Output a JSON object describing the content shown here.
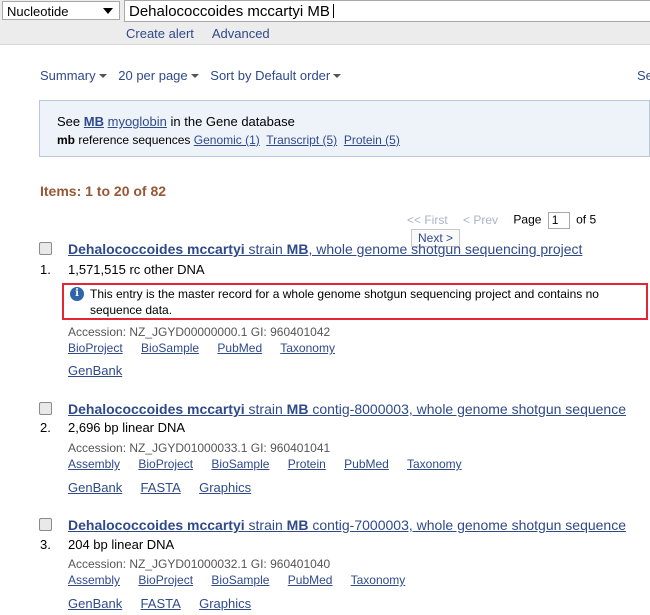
{
  "search": {
    "database": "Nucleotide",
    "query": "Dehalococcoides mccartyi MB",
    "links": [
      "Create alert",
      "Advanced"
    ]
  },
  "toolbar": {
    "summary": "Summary",
    "per_page": "20 per page",
    "sort": "Sort by Default order",
    "send": "Se"
  },
  "gene_box": {
    "see": "See",
    "gene_symbol": "MB",
    "gene_name": "myoglobin",
    "suffix": "in the Gene database",
    "ref_symbol": "mb",
    "ref_text": "reference sequences",
    "genomic": "Genomic (1)",
    "transcript": "Transcript (5)",
    "protein": "Protein (5)"
  },
  "results": {
    "items_label": "Items: 1 to 20 of 82",
    "pager": {
      "first": "<< First",
      "prev": "< Prev",
      "page_label": "Page",
      "page_value": "1",
      "of": "of 5",
      "next": "Next >"
    }
  },
  "records": [
    {
      "num": "1.",
      "title_bold1": "Dehalococcoides mccartyi",
      "title_mid": " strain ",
      "title_bold2": "MB",
      "title_rest": ", whole genome shotgun sequencing project",
      "desc": "1,571,515 rc other DNA",
      "notice": "This entry is the master record for a whole genome shotgun sequencing project and contains no sequence data.",
      "accession": "Accession: NZ_JGYD00000000.1   GI: 960401042",
      "links": [
        "BioProject",
        "BioSample",
        "PubMed",
        "Taxonomy"
      ],
      "links2": [
        "GenBank"
      ]
    },
    {
      "num": "2.",
      "title_bold1": "Dehalococcoides mccartyi",
      "title_mid": " strain ",
      "title_bold2": "MB",
      "title_rest": " contig-8000003, whole genome shotgun sequence",
      "desc": "2,696 bp linear DNA",
      "accession": "Accession: NZ_JGYD01000033.1   GI: 960401041",
      "links": [
        "Assembly",
        "BioProject",
        "BioSample",
        "Protein",
        "PubMed",
        "Taxonomy"
      ],
      "links2": [
        "GenBank",
        "FASTA",
        "Graphics"
      ]
    },
    {
      "num": "3.",
      "title_bold1": "Dehalococcoides mccartyi",
      "title_mid": " strain ",
      "title_bold2": "MB",
      "title_rest": " contig-7000003, whole genome shotgun sequence",
      "desc": "204 bp linear DNA",
      "accession": "Accession: NZ_JGYD01000032.1   GI: 960401040",
      "links": [
        "Assembly",
        "BioProject",
        "BioSample",
        "PubMed",
        "Taxonomy"
      ],
      "links2": [
        "GenBank",
        "FASTA",
        "Graphics"
      ]
    }
  ],
  "colors": {
    "link": "#2f4a8a",
    "items_heading": "#985735",
    "highlight_border": "#e32636",
    "gene_box_bg": "#eef3fa"
  }
}
